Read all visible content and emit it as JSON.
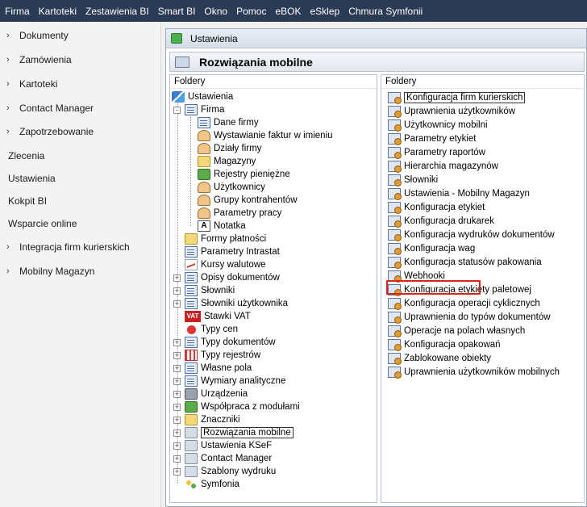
{
  "menu": [
    "Firma",
    "Kartoteki",
    "Zestawienia BI",
    "Smart BI",
    "Okno",
    "Pomoc",
    "eBOK",
    "eSklep",
    "Chmura Symfonii"
  ],
  "nav": [
    {
      "label": "Dokumenty",
      "chevron": true
    },
    {
      "label": "Zamówienia",
      "chevron": true
    },
    {
      "label": "Kartoteki",
      "chevron": true
    },
    {
      "label": "Contact Manager",
      "chevron": true
    },
    {
      "label": "Zapotrzebowanie",
      "chevron": true
    },
    {
      "label": "Zlecenia",
      "chevron": false
    },
    {
      "label": "Ustawienia",
      "chevron": false
    },
    {
      "label": "Kokpit BI",
      "chevron": false
    },
    {
      "label": "Wsparcie online",
      "chevron": false
    },
    {
      "label": "Integracja firm kurierskich",
      "chevron": true
    },
    {
      "label": "Mobilny Magazyn",
      "chevron": true
    }
  ],
  "window": {
    "title": "Ustawienia",
    "subtitle": "Rozwiązania mobilne"
  },
  "left_pane": {
    "header": "Foldery",
    "tree": [
      {
        "label": "Ustawienia",
        "icon": "tools-icon",
        "level": 0,
        "expander": ""
      },
      {
        "label": "Firma",
        "icon": "building-icon",
        "level": 1,
        "expander": "-"
      },
      {
        "label": "Dane firmy",
        "icon": "building-icon",
        "level": 2,
        "expander": ""
      },
      {
        "label": "Wystawianie faktur w imieniu",
        "icon": "user-icon",
        "level": 2,
        "expander": ""
      },
      {
        "label": "Działy firmy",
        "icon": "users-icon",
        "level": 2,
        "expander": ""
      },
      {
        "label": "Magazyny",
        "icon": "folder-icon",
        "level": 2,
        "expander": ""
      },
      {
        "label": "Rejestry pieniężne",
        "icon": "money-icon",
        "level": 2,
        "expander": ""
      },
      {
        "label": "Użytkownicy",
        "icon": "users-icon",
        "level": 2,
        "expander": ""
      },
      {
        "label": "Grupy kontrahentów",
        "icon": "users-icon",
        "level": 2,
        "expander": ""
      },
      {
        "label": "Parametry pracy",
        "icon": "user-icon",
        "level": 2,
        "expander": ""
      },
      {
        "label": "Notatka",
        "icon": "letter-a-icon",
        "level": 2,
        "expander": ""
      },
      {
        "label": "Formy płatności",
        "icon": "folder-icon",
        "level": 1,
        "expander": ""
      },
      {
        "label": "Parametry Intrastat",
        "icon": "document-icon",
        "level": 1,
        "expander": ""
      },
      {
        "label": "Kursy walutowe",
        "icon": "chart-icon",
        "level": 1,
        "expander": ""
      },
      {
        "label": "Opisy dokumentów",
        "icon": "document-icon",
        "level": 1,
        "expander": "+"
      },
      {
        "label": "Słowniki",
        "icon": "document-icon",
        "level": 1,
        "expander": "+"
      },
      {
        "label": "Słowniki użytkownika",
        "icon": "document-icon",
        "level": 1,
        "expander": "+"
      },
      {
        "label": "Stawki VAT",
        "icon": "vat-icon",
        "level": 1,
        "expander": ""
      },
      {
        "label": "Typy cen",
        "icon": "red-dot-icon",
        "level": 1,
        "expander": ""
      },
      {
        "label": "Typy dokumentów",
        "icon": "document-icon",
        "level": 1,
        "expander": "+"
      },
      {
        "label": "Typy rejestrów",
        "icon": "grid-icon",
        "level": 1,
        "expander": "+"
      },
      {
        "label": "Własne pola",
        "icon": "document-icon",
        "level": 1,
        "expander": "+"
      },
      {
        "label": "Wymiary analityczne",
        "icon": "document-icon",
        "level": 1,
        "expander": "+"
      },
      {
        "label": "Urządzenia",
        "icon": "printer-icon",
        "level": 1,
        "expander": "+"
      },
      {
        "label": "Współpraca z modułami",
        "icon": "green-icon",
        "level": 1,
        "expander": "+"
      },
      {
        "label": "Znaczniki",
        "icon": "tags-icon",
        "level": 1,
        "expander": "+"
      },
      {
        "label": "Rozwiązania mobilne",
        "icon": "folder-gray-icon",
        "level": 1,
        "expander": "+",
        "selected": true
      },
      {
        "label": "Ustawienia KSeF",
        "icon": "folder-gray-icon",
        "level": 1,
        "expander": "+"
      },
      {
        "label": "Contact Manager",
        "icon": "folder-gray-icon",
        "level": 1,
        "expander": "+"
      },
      {
        "label": "Szablony wydruku",
        "icon": "folder-gray-icon",
        "level": 1,
        "expander": "+"
      },
      {
        "label": "Symfonia",
        "icon": "symfonia-icon",
        "level": 1,
        "expander": ""
      }
    ]
  },
  "right_pane": {
    "header": "Foldery",
    "items": [
      "Konfiguracja firm kurierskich",
      "Uprawnienia użytkowników",
      "Użytkownicy mobilni",
      "Parametry etykiet",
      "Parametry raportów",
      "Hierarchia magazynów",
      "Słowniki",
      "Ustawienia - Mobilny Magazyn",
      "Konfiguracja etykiet",
      "Konfiguracja drukarek",
      "Konfiguracja wydruków dokumentów",
      "Konfiguracja wag",
      "Konfiguracja statusów pakowania",
      "Webhooki",
      "Konfiguracja etykiety paletowej",
      "Konfiguracja operacji cyklicznych",
      "Uprawnienia do typów dokumentów",
      "Operacje na polach własnych",
      "Konfiguracja opakowań",
      "Zablokowane obiekty",
      "Uprawnienia użytkowników mobilnych"
    ]
  }
}
